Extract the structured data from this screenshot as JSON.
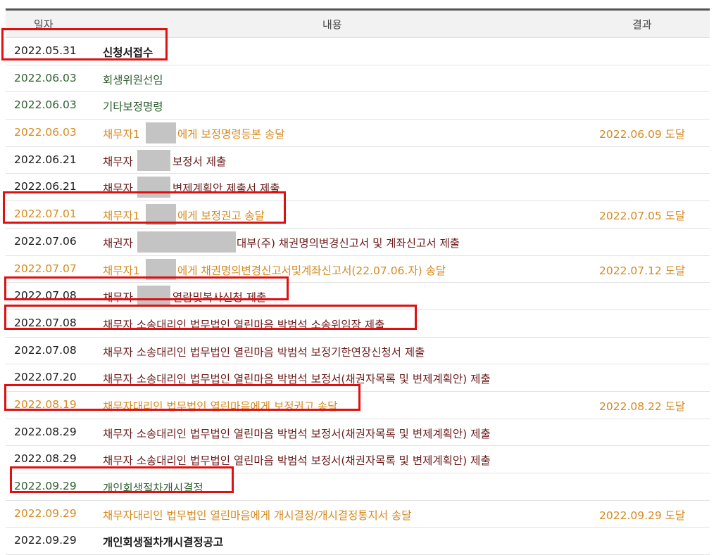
{
  "header": {
    "date": "일자",
    "content": "내용",
    "result": "결과"
  },
  "rows": [
    {
      "date": "2022.05.31",
      "content": "신청서접수",
      "result": "",
      "color": "black"
    },
    {
      "date": "2022.06.03",
      "content": "회생위원선임",
      "result": "",
      "color": "green"
    },
    {
      "date": "2022.06.03",
      "content": "기타보정명령",
      "result": "",
      "color": "green"
    },
    {
      "date": "2022.06.03",
      "content": "채무자1",
      "content2": "에게 보정명령등본 송달",
      "result": "2022.06.09 도달",
      "color": "orange"
    },
    {
      "date": "2022.06.21",
      "content": "채무자",
      "content2": "보정서 제출",
      "result": "",
      "color": "maroon"
    },
    {
      "date": "2022.06.21",
      "content": "채무자",
      "content2": "변제계획안 제출서 제출",
      "result": "",
      "color": "maroon"
    },
    {
      "date": "2022.07.01",
      "content": "채무자1",
      "content2": "에게 보정권고 송달",
      "result": "2022.07.05 도달",
      "color": "orange"
    },
    {
      "date": "2022.07.06",
      "content": "채권자",
      "content2": "대부(주) 채권명의변경신고서 및 계좌신고서 제출",
      "result": "",
      "color": "maroon"
    },
    {
      "date": "2022.07.07",
      "content": "채무자1",
      "content2": "에게 채권명의변경신고서및계좌신고서(22.07.06.자) 송달",
      "result": "2022.07.12 도달",
      "color": "orange"
    },
    {
      "date": "2022.07.08",
      "content": "채무자",
      "content2": "열람및복사신청 제출",
      "result": "",
      "color": "maroon"
    },
    {
      "date": "2022.07.08",
      "content": "채무자 소송대리인 법무법인 열린마음 박범석 소송위임장 제출",
      "result": "",
      "color": "maroon"
    },
    {
      "date": "2022.07.08",
      "content": "채무자 소송대리인 법무법인 열린마음 박범석 보정기한연장신청서 제출",
      "result": "",
      "color": "maroon"
    },
    {
      "date": "2022.07.20",
      "content": "채무자 소송대리인 법무법인 열린마음 박범석 보정서(채권자목록 및 변제계획안) 제출",
      "result": "",
      "color": "maroon"
    },
    {
      "date": "2022.08.19",
      "content": "채무자대리인 법무법인 열린마음에게 보정권고 송달",
      "result": "2022.08.22 도달",
      "color": "orange"
    },
    {
      "date": "2022.08.29",
      "content": "채무자 소송대리인 법무법인 열린마음 박범석 보정서(채권자목록 및 변제계획안) 제출",
      "result": "",
      "color": "maroon"
    },
    {
      "date": "2022.08.29",
      "content": "채무자 소송대리인 법무법인 열린마음 박범석 보정서(채권자목록 및 변제계획안) 제출",
      "result": "",
      "color": "maroon"
    },
    {
      "date": "2022.09.29",
      "content": "개인회생절차개시결정",
      "result": "",
      "color": "green"
    },
    {
      "date": "2022.09.29",
      "content": "채무자대리인 법무법인 열린마음에게 개시결정/개시결정통지서 송달",
      "result": "2022.09.29 도달",
      "color": "orange"
    },
    {
      "date": "2022.09.29",
      "content": "개인회생절차개시결정공고",
      "result": "",
      "color": "black"
    }
  ]
}
